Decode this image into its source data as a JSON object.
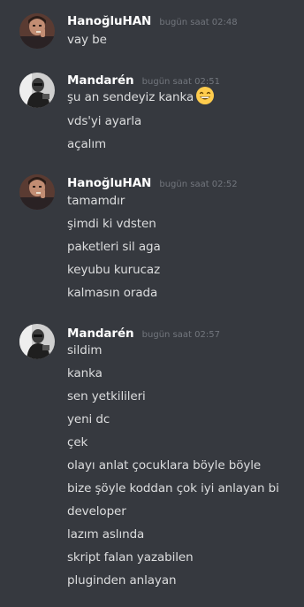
{
  "messages": [
    {
      "author": "HanoğluHAN",
      "timestamp": "bugün saat 02:48",
      "avatar": "avatar-hanogluhan",
      "lines": [
        "vay be"
      ]
    },
    {
      "author": "Mandarén",
      "timestamp": "bugün saat 02:51",
      "avatar": "avatar-mandaren",
      "lines": [
        "şu an sendeyiz kanka",
        "vds'yi ayarla",
        "açalım"
      ],
      "emoji": "grinning-smile-emoji"
    },
    {
      "author": "HanoğluHAN",
      "timestamp": "bugün saat 02:52",
      "avatar": "avatar-hanogluhan",
      "lines": [
        "tamamdır",
        "şimdi ki vdsten",
        "paketleri sil aga",
        "keyubu kurucaz",
        "kalmasın orada"
      ]
    },
    {
      "author": "Mandarén",
      "timestamp": "bugün saat 02:57",
      "avatar": "avatar-mandaren",
      "lines": [
        "sildim",
        "kanka",
        "sen yetkilileri",
        "yeni dc",
        "çek",
        "olayı anlat çocuklara böyle böyle",
        "bize şöyle koddan çok iyi anlayan bi",
        "developer",
        "lazım aslında",
        "skript falan yazabilen",
        "pluginden anlayan"
      ]
    }
  ],
  "colors": {
    "background": "#36393f",
    "username": "#ffffff",
    "timestamp": "#72767d",
    "text": "#dcddde"
  }
}
